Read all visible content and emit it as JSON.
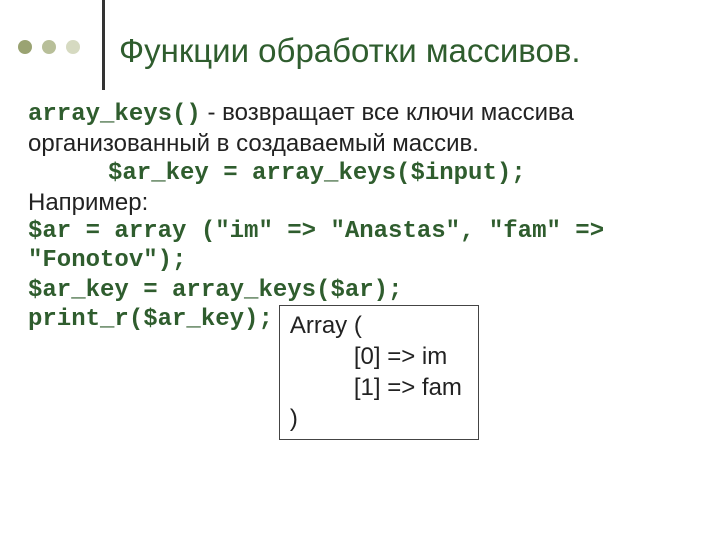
{
  "title": "Функции обработки массивов.",
  "line1_code": "array_keys()",
  "line1_text": " - возвращает все ключи массива организованный в создаваемый массив.",
  "code1": "$ar_key = array_keys($input);",
  "example_label": "Например:",
  "code2": "$ar = array (\"im\" => \"Anastas\", \"fam\" => \"Fonotov\");",
  "code3": "$ar_key = array_keys($ar);",
  "code4": "print_r($ar_key);",
  "output": {
    "head": "Array (",
    "l0": "[0] => im",
    "l1": "[1] => fam",
    "close": ")"
  }
}
